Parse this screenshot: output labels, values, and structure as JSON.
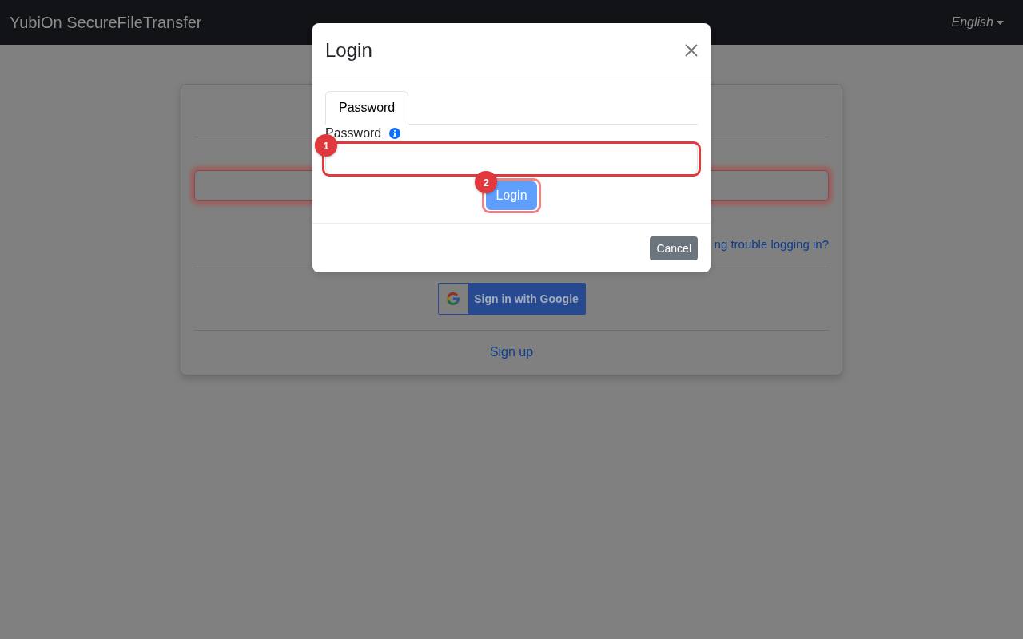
{
  "navbar": {
    "brand": "YubiOn SecureFileTransfer",
    "language_menu": "English"
  },
  "login_card": {
    "id_field": {
      "highlighted": true
    },
    "help_link": "ng trouble logging in?",
    "google_button": "Sign in with Google",
    "signup_link": "Sign up"
  },
  "login_dialog": {
    "title": "Login",
    "tabs": [
      {
        "label": "Password",
        "selected": true
      }
    ],
    "password_field": {
      "label": "Password"
    },
    "login_button": {
      "label": "Login",
      "disabled": true
    },
    "cancel_button": "Cancel"
  },
  "annotations": [
    {
      "label": "1",
      "kind": "field"
    },
    {
      "label": "2",
      "kind": "button"
    }
  ]
}
